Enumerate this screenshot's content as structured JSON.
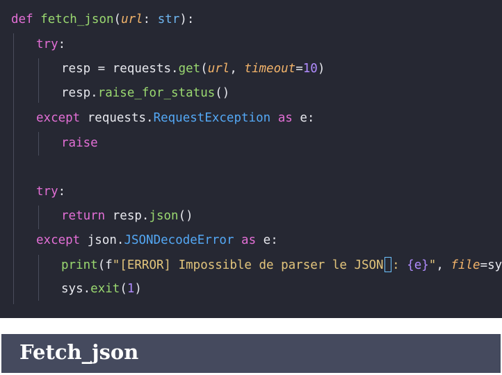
{
  "code": {
    "line1": {
      "t1": "def",
      "t2": "fetch_json",
      "t3": "(",
      "t4": "url",
      "t5": ":",
      "t6": "str",
      "t7": "):"
    },
    "line2": {
      "t1": "try",
      "t2": ":"
    },
    "line3": {
      "t1": "resp = requests.",
      "t2": "get",
      "t3": "(",
      "t4": "url",
      "t5": ", ",
      "t6": "timeout",
      "t7": "=",
      "t8": "10",
      "t9": ")"
    },
    "line4": {
      "t1": "resp.",
      "t2": "raise_for_status",
      "t3": "()"
    },
    "line5": {
      "t1": "except",
      "t2": " requests.",
      "t3": "RequestException",
      "t4": "as",
      "t5": "e:"
    },
    "line6": {
      "t1": "raise"
    },
    "line7": {
      "t1": "try",
      "t2": ":"
    },
    "line8": {
      "t1": "return",
      "t2": "resp.",
      "t3": "json",
      "t4": "()"
    },
    "line9": {
      "t1": "except",
      "t2": "json.",
      "t3": "JSONDecodeError",
      "t4": "as",
      "t5": "e:"
    },
    "line10": {
      "t1": "print",
      "t2": "(f",
      "t3": "\"[ERROR] Impossible de parser le JSON",
      "t4": ": ",
      "t5": "{e}",
      "t6": "\"",
      "t7": ", ",
      "t8": "file",
      "t9": "=sys.stderr)"
    },
    "line11": {
      "t1": "sys.",
      "t2": "exit",
      "t3": "(",
      "t4": "1",
      "t5": ")"
    }
  },
  "footer": {
    "title": "Fetch_json"
  },
  "colors": {
    "editor_bg": "#262833",
    "keyword": "#e36fd6",
    "function": "#9ad870",
    "parameter": "#f2b36a",
    "class": "#54a8f5",
    "number": "#b18cff",
    "string": "#e3c57c",
    "title_bar": "#454a5e"
  }
}
